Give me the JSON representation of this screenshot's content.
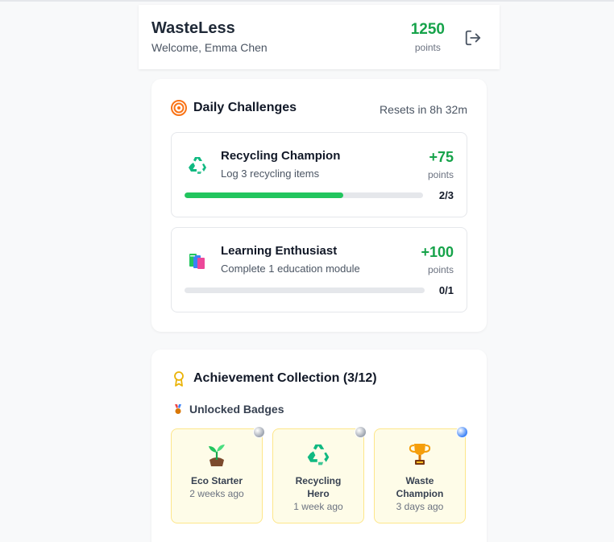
{
  "header": {
    "title": "WasteLess",
    "welcome": "Welcome, Emma Chen",
    "points_value": "1250",
    "points_label": "points",
    "logout_icon": "logout-icon"
  },
  "daily": {
    "title": "Daily Challenges",
    "resets": "Resets in 8h 32m",
    "challenges": [
      {
        "icon": "recycle-icon",
        "title": "Recycling Champion",
        "desc": "Log 3 recycling items",
        "reward": "+75",
        "reward_label": "points",
        "progress": 0.667,
        "count": "2/3"
      },
      {
        "icon": "books-icon",
        "title": "Learning Enthusiast",
        "desc": "Complete 1 education module",
        "reward": "+100",
        "reward_label": "points",
        "progress": 0,
        "count": "0/1"
      }
    ]
  },
  "achievements": {
    "title": "Achievement Collection (3/12)",
    "unlocked_title": "Unlocked Badges",
    "badges": [
      {
        "icon": "seedling-icon",
        "name": "Eco Starter",
        "time": "2 weeks ago",
        "tier_color": "#9ca3af"
      },
      {
        "icon": "recycle-icon",
        "name": "Recycling Hero",
        "time": "1 week ago",
        "tier_color": "#9ca3af"
      },
      {
        "icon": "trophy-icon",
        "name": "Waste Champion",
        "time": "3 days ago",
        "tier_color": "#3b82f6"
      }
    ]
  },
  "colors": {
    "accent_green": "#16a34a",
    "progress_green": "#22c55e",
    "badge_bg": "#fefce8"
  }
}
